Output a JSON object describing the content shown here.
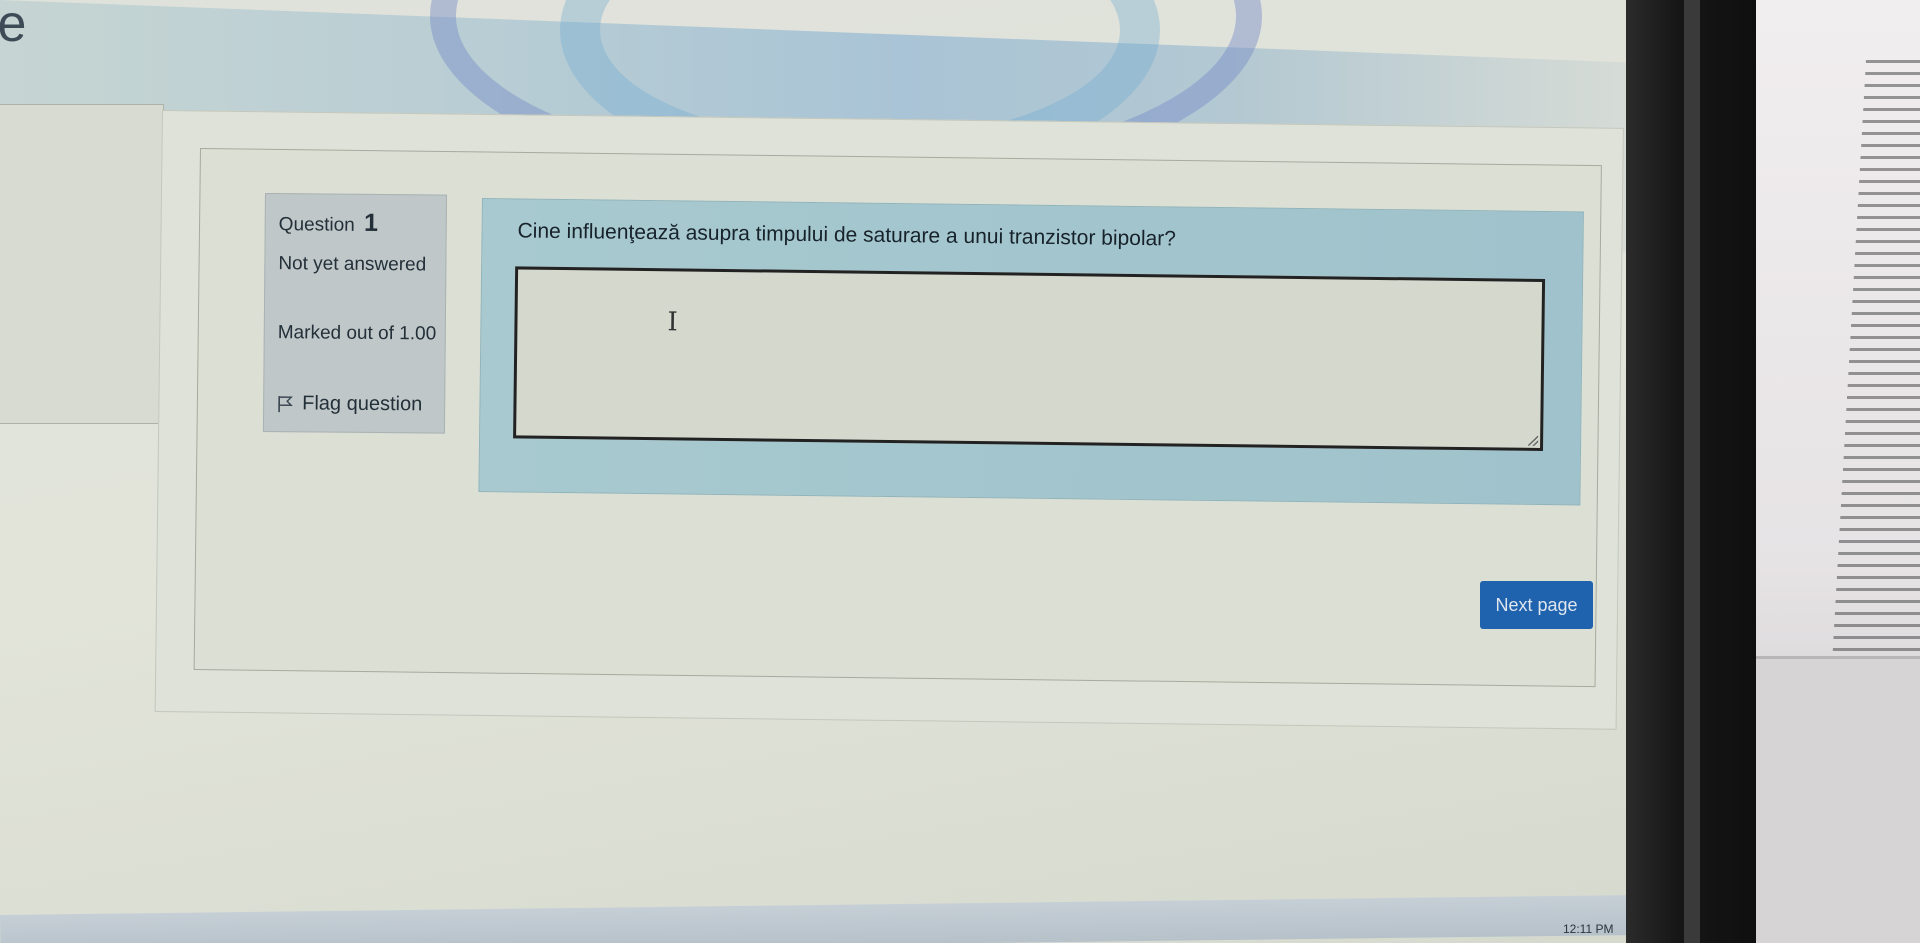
{
  "site": {
    "title_fragment": "le"
  },
  "question_info": {
    "label": "Question",
    "number": "1",
    "state": "Not yet answered",
    "grade": "Marked out of 1.00",
    "flag_label": "Flag question"
  },
  "question": {
    "text": "Cine influenţează asupra timpului de saturare a unui tranzistor bipolar?",
    "answer_value": ""
  },
  "navigation": {
    "next_label": "Next page"
  },
  "taskbar": {
    "clock": "12:11 PM"
  },
  "colors": {
    "accent": "#1f62ad",
    "formulation_bg": "#a7c9cf",
    "info_bg": "#bfc7c8"
  },
  "icons": {
    "flag": "flag-icon",
    "text_cursor": "text-cursor-icon",
    "notifications": "notification-icon"
  }
}
